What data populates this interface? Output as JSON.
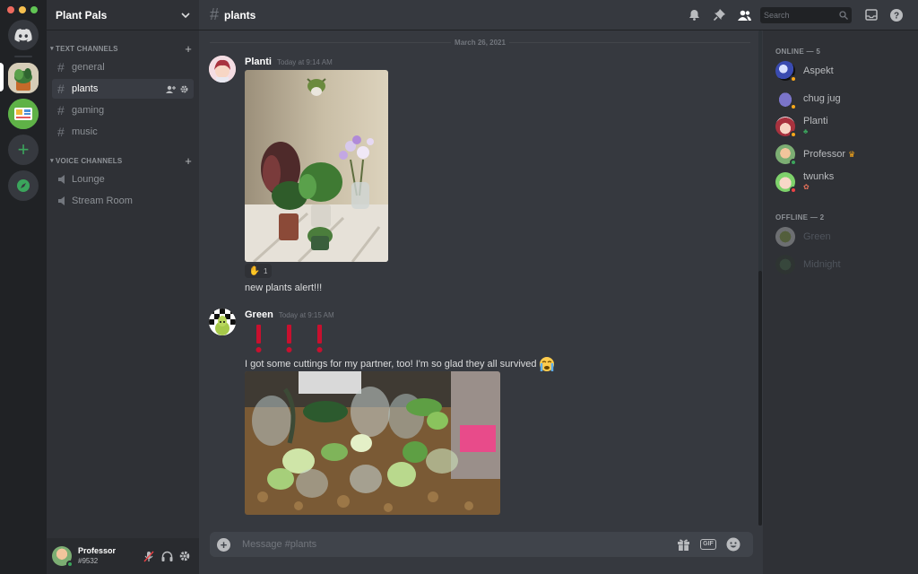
{
  "colors": {
    "accent": "#5865f2",
    "online": "#3ba55c",
    "idle": "#faa81a",
    "dnd": "#ed4245",
    "text_muted": "#72767d"
  },
  "window": {
    "traffic_lights": [
      "#ed6a5e",
      "#f5bf4f",
      "#61c554"
    ]
  },
  "rail": {
    "home_icon": "discord-logo-icon",
    "servers": [
      {
        "name": "plant-pals-server"
      },
      {
        "name": "green-server"
      }
    ],
    "add_server_icon": "plus-icon",
    "explore_icon": "compass-icon"
  },
  "sidebar": {
    "server_name": "Plant Pals",
    "categories": [
      {
        "label": "TEXT CHANNELS",
        "channels": [
          "general",
          "plants",
          "gaming",
          "music"
        ]
      },
      {
        "label": "VOICE CHANNELS",
        "channels": [
          "Lounge",
          "Stream Room"
        ]
      }
    ],
    "active_channel": "plants"
  },
  "user": {
    "name": "Professor",
    "tag": "#9532",
    "status": "online"
  },
  "topbar": {
    "channel": "plants",
    "search_placeholder": "Search"
  },
  "chat": {
    "date_divider": "March 26, 2021",
    "messages": [
      {
        "author": "Planti",
        "timestamp": "Today at 9:14 AM",
        "reaction_count": "1",
        "text": "new plants alert!!!"
      },
      {
        "author": "Green",
        "timestamp": "Today at 9:15 AM",
        "text": "I got some cuttings for my partner, too! I'm so glad they all survived"
      }
    ]
  },
  "composer": {
    "placeholder": "Message #plants",
    "gif_label": "GIF"
  },
  "members": {
    "online_label": "ONLINE — 5",
    "offline_label": "OFFLINE — 2",
    "online": [
      {
        "name": "Aspekt",
        "status": "idle"
      },
      {
        "name": "chug jug",
        "status": "idle"
      },
      {
        "name": "Planti",
        "status": "idle",
        "activity": "plant-emoji"
      },
      {
        "name": "Professor",
        "status": "online",
        "badge": "crown-icon"
      },
      {
        "name": "twunks",
        "status": "dnd",
        "activity": "custom-emoji"
      }
    ],
    "offline": [
      {
        "name": "Green"
      },
      {
        "name": "Midnight"
      }
    ]
  }
}
